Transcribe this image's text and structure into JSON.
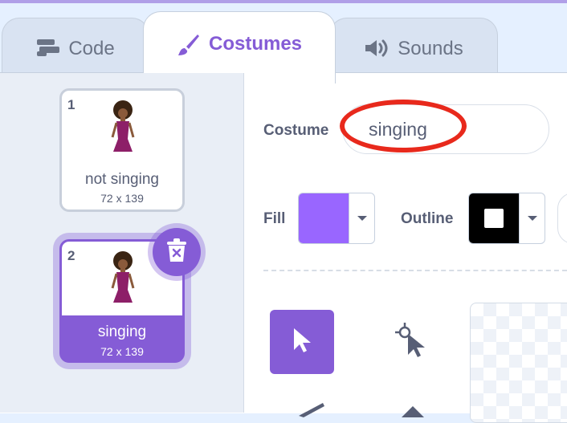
{
  "tabs": [
    {
      "label": "Code",
      "icon": "code-blocks-icon"
    },
    {
      "label": "Costumes",
      "icon": "paintbrush-icon",
      "selected": true
    },
    {
      "label": "Sounds",
      "icon": "speaker-icon"
    }
  ],
  "costumes": [
    {
      "number": "1",
      "name": "not singing",
      "size": "72 x 139",
      "selected": false
    },
    {
      "number": "2",
      "name": "singing",
      "size": "72 x 139",
      "selected": true
    }
  ],
  "editor": {
    "costume_label": "Costume",
    "costume_name": "singing",
    "fill_label": "Fill",
    "outline_label": "Outline",
    "fill_color": "#9966ff",
    "outline_color": "#000000"
  },
  "tools": [
    "select-tool",
    "reshape-tool"
  ],
  "colors": {
    "accent": "#855cd6",
    "highlight_ring": "#e8291c"
  }
}
